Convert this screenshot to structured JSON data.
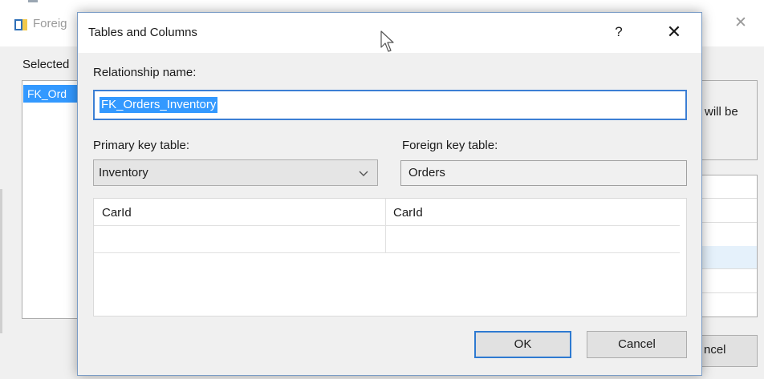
{
  "background_window": {
    "title": "Foreig",
    "selected_label": "Selected",
    "list_item": "FK_Ord",
    "partial_text": "will be",
    "partial_button": "ncel"
  },
  "dialog": {
    "title": "Tables and Columns",
    "help_glyph": "?",
    "close_glyph": "✕",
    "relationship_name_label": "Relationship name:",
    "relationship_name_value": "FK_Orders_Inventory",
    "primary_key_label": "Primary key table:",
    "primary_key_value": "Inventory",
    "foreign_key_label": "Foreign key table:",
    "foreign_key_value": "Orders",
    "columns": [
      {
        "primary": "CarId",
        "foreign": "CarId"
      },
      {
        "primary": "",
        "foreign": ""
      }
    ],
    "ok_label": "OK",
    "cancel_label": "Cancel"
  },
  "icons": {
    "app": "app-icon",
    "cursor": "mouse-pointer-icon",
    "dropdown": "chevron-down-icon"
  },
  "colors": {
    "selection": "#3399ff",
    "focus_border": "#3c7fd4",
    "dialog_bg": "#f0f0f0"
  }
}
